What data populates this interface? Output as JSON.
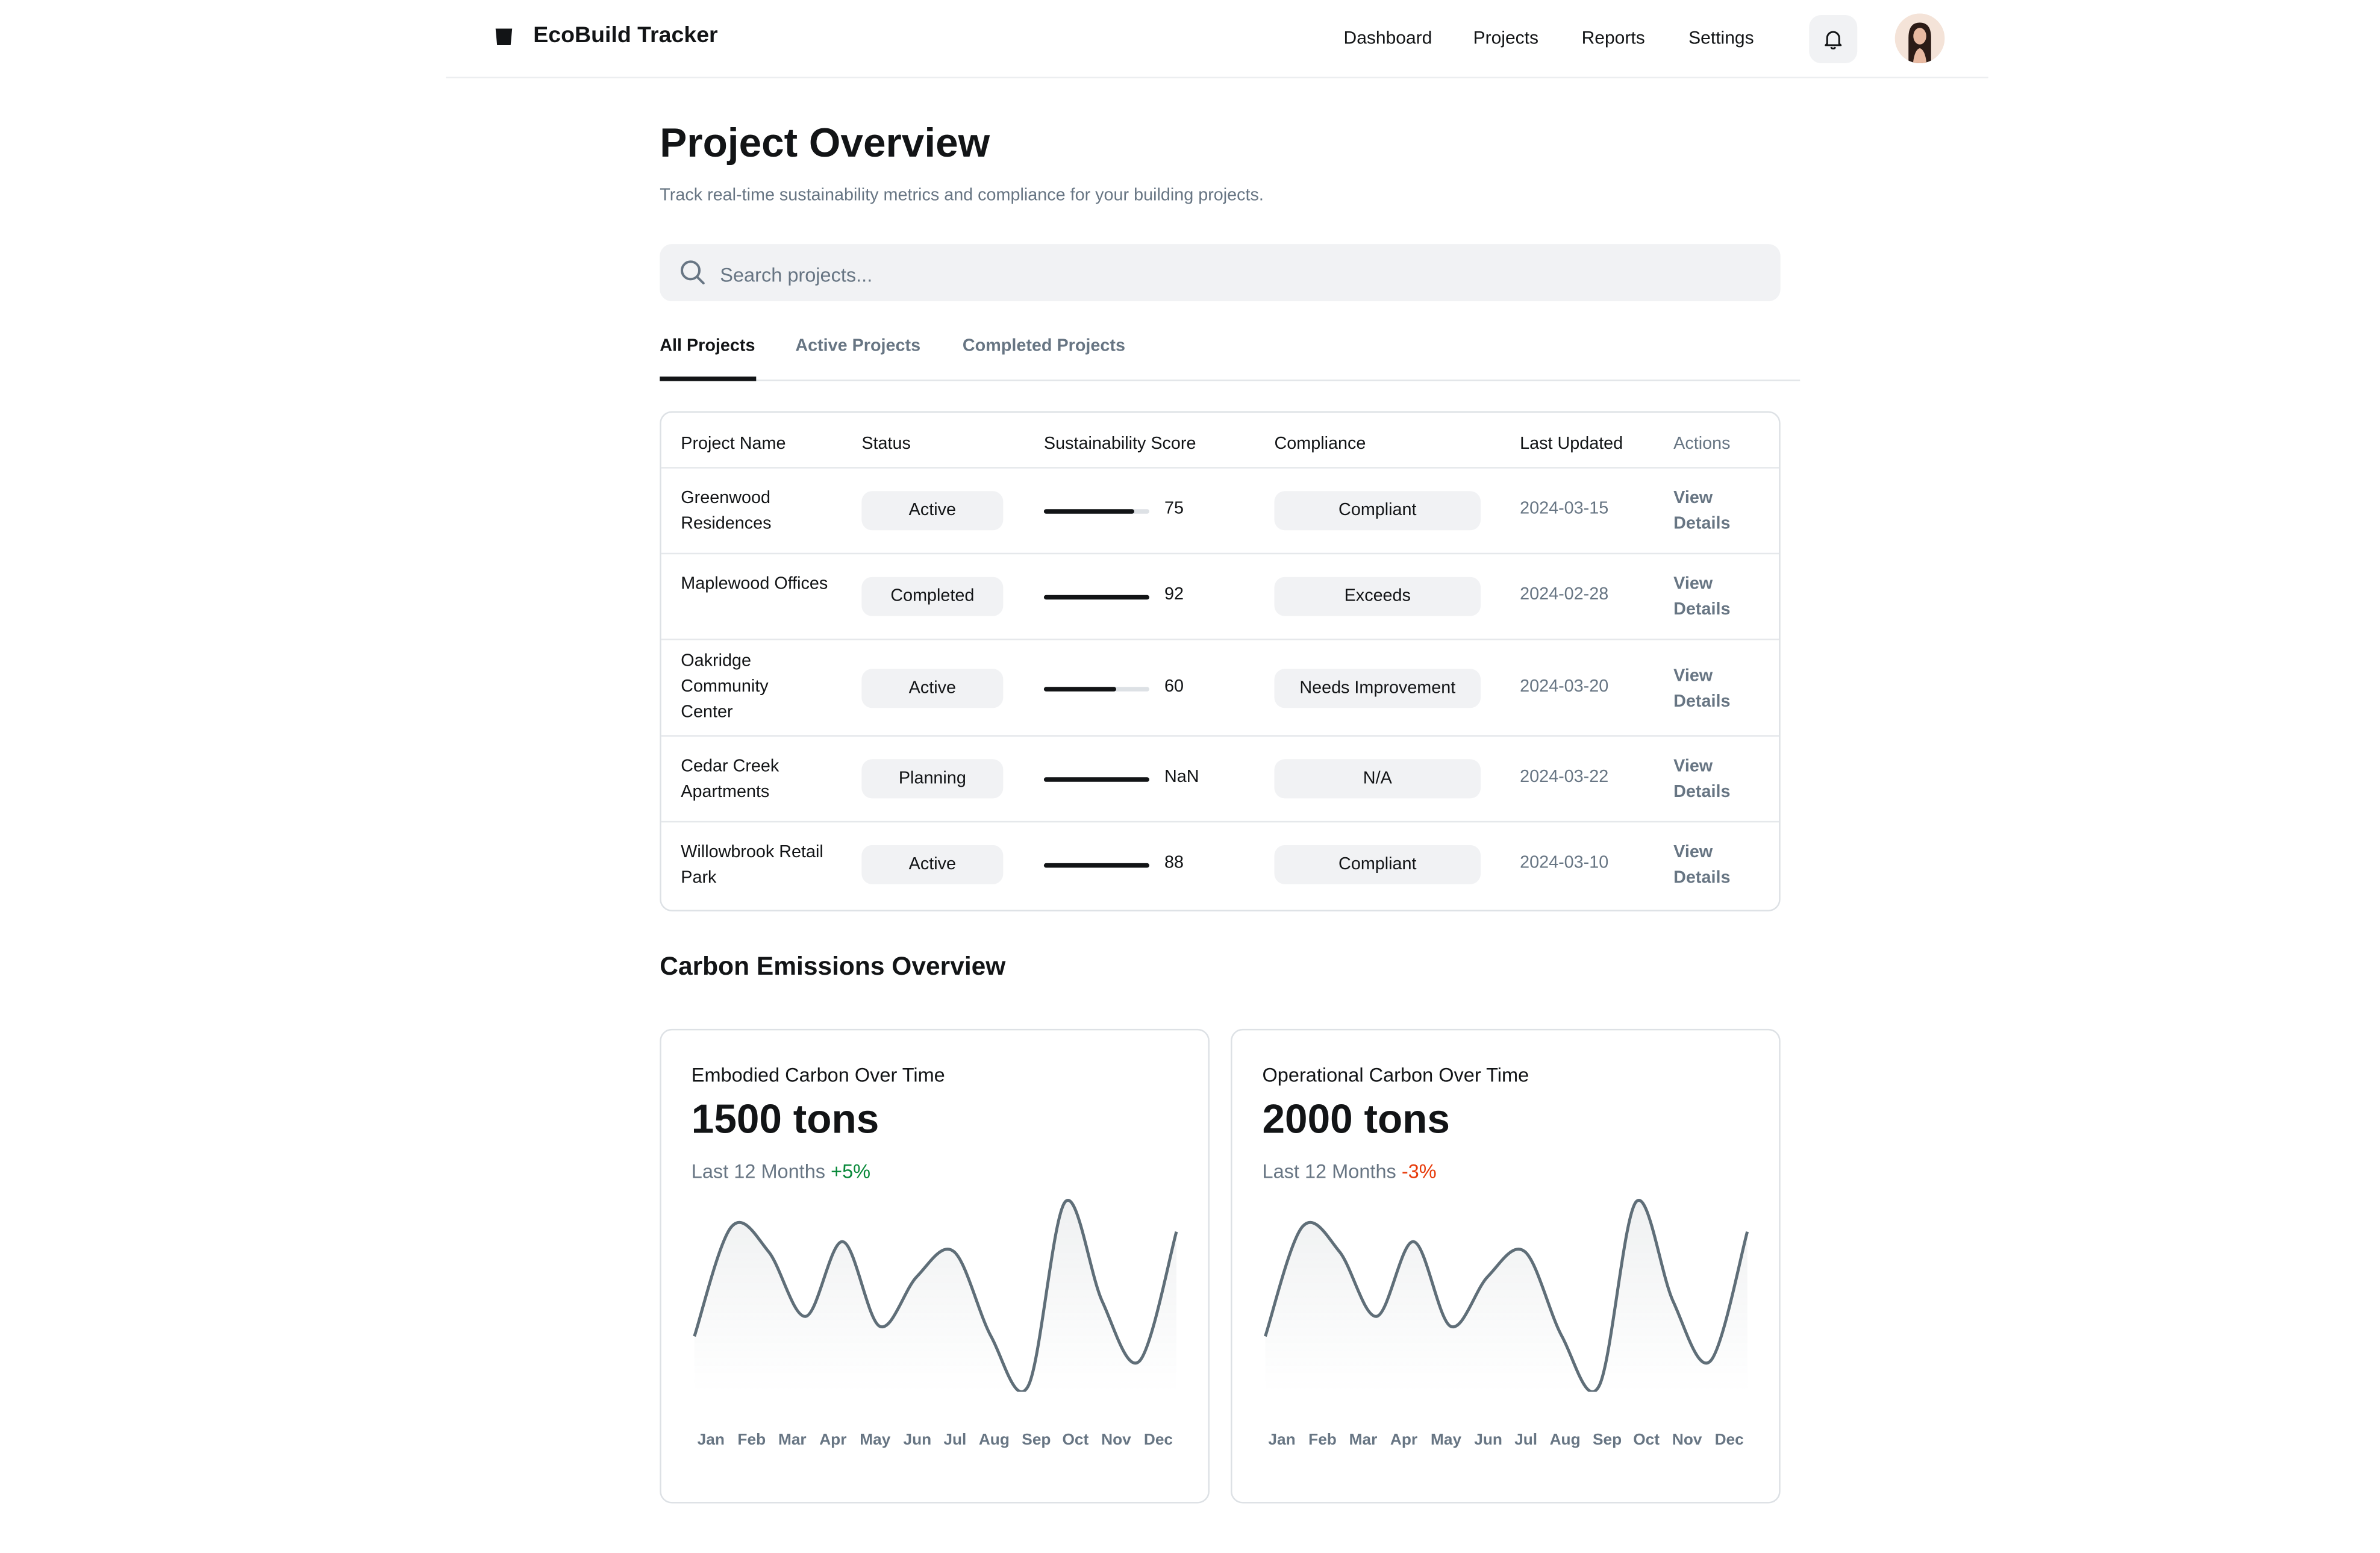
{
  "header": {
    "brand": "EcoBuild Tracker",
    "nav": [
      "Dashboard",
      "Projects",
      "Reports",
      "Settings"
    ],
    "icons": {
      "logo": "square-logo-icon",
      "bell": "bell-icon",
      "avatar": "user-avatar"
    }
  },
  "page": {
    "title": "Project Overview",
    "subtitle": "Track real-time sustainability metrics and compliance for your building projects."
  },
  "search": {
    "placeholder": "Search projects...",
    "icon": "search-icon"
  },
  "tabs": [
    {
      "label": "All Projects",
      "active": true
    },
    {
      "label": "Active Projects",
      "active": false
    },
    {
      "label": "Completed Projects",
      "active": false
    }
  ],
  "table": {
    "columns": [
      "Project Name",
      "Status",
      "Sustainability Score",
      "Compliance",
      "Last Updated",
      "Actions"
    ],
    "rows": [
      {
        "name": "Greenwood Residences",
        "status": "Active",
        "score": "75",
        "score_fraction": 0.85,
        "compliance": "Compliant",
        "updated": "2024-03-15",
        "action": "View Details"
      },
      {
        "name": "Maplewood Offices",
        "status": "Completed",
        "score": "92",
        "score_fraction": 1.0,
        "compliance": "Exceeds",
        "updated": "2024-02-28",
        "action": "View Details"
      },
      {
        "name": "Oakridge Community Center",
        "status": "Active",
        "score": "60",
        "score_fraction": 0.68,
        "compliance": "Needs Improvement",
        "updated": "2024-03-20",
        "action": "View Details"
      },
      {
        "name": "Cedar Creek Apartments",
        "status": "Planning",
        "score": "NaN",
        "score_fraction": 1.0,
        "compliance": "N/A",
        "updated": "2024-03-22",
        "action": "View Details"
      },
      {
        "name": "Willowbrook Retail Park",
        "status": "Active",
        "score": "88",
        "score_fraction": 1.0,
        "compliance": "Compliant",
        "updated": "2024-03-10",
        "action": "View Details"
      }
    ]
  },
  "carbon": {
    "title": "Carbon Emissions Overview",
    "colors": {
      "positive": "#078838",
      "negative": "#e73908",
      "line": "#5f6e78"
    },
    "cards": [
      {
        "title": "Embodied Carbon Over Time",
        "value": "1500 tons",
        "period": "Last 12 Months",
        "change": "+5%",
        "trend": "positive"
      },
      {
        "title": "Operational Carbon Over Time",
        "value": "2000 tons",
        "period": "Last 12 Months",
        "change": "-3%",
        "trend": "negative"
      }
    ]
  },
  "chart_data": [
    {
      "type": "line",
      "categories": [
        "Jan",
        "Feb",
        "Mar",
        "Apr",
        "May",
        "Jun",
        "Jul",
        "Aug",
        "Sep",
        "Oct",
        "Nov",
        "Dec"
      ],
      "values": [
        109,
        21,
        41,
        93,
        33,
        101,
        61,
        41,
        109,
        149,
        1,
        81,
        129,
        25
      ]
    },
    {
      "type": "line",
      "categories": [
        "Jan",
        "Feb",
        "Mar",
        "Apr",
        "May",
        "Jun",
        "Jul",
        "Aug",
        "Sep",
        "Oct",
        "Nov",
        "Dec"
      ],
      "values": [
        109,
        21,
        41,
        93,
        33,
        101,
        61,
        41,
        109,
        149,
        1,
        81,
        129,
        25
      ]
    }
  ]
}
